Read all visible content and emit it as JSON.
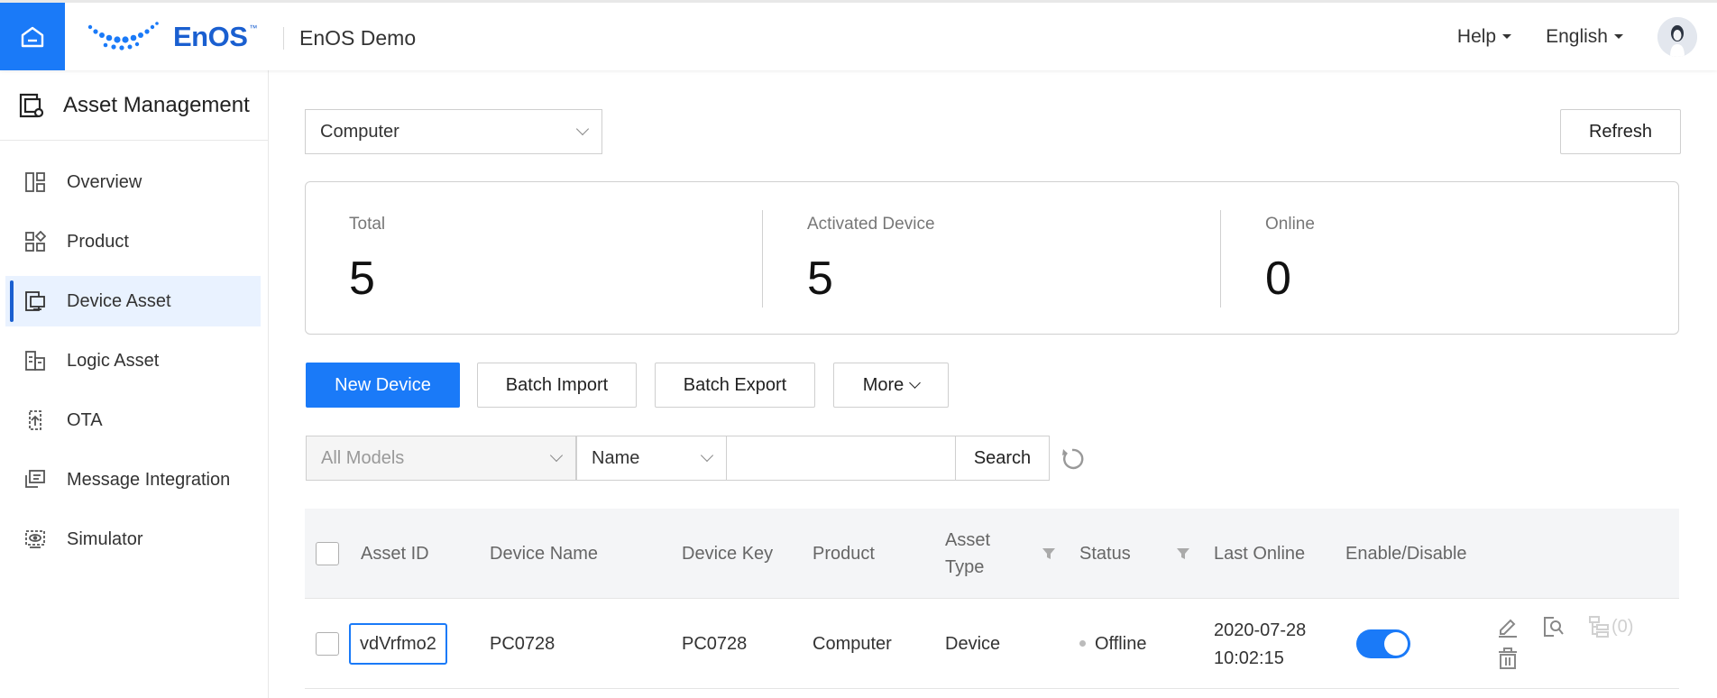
{
  "header": {
    "logo_text": "EnOS",
    "logo_tm": "™",
    "app_title": "EnOS Demo",
    "help_label": "Help",
    "language_label": "English"
  },
  "sidebar": {
    "title": "Asset Management",
    "items": [
      {
        "label": "Overview",
        "icon": "overview-icon"
      },
      {
        "label": "Product",
        "icon": "product-icon"
      },
      {
        "label": "Device Asset",
        "icon": "device-asset-icon",
        "active": true
      },
      {
        "label": "Logic Asset",
        "icon": "logic-asset-icon"
      },
      {
        "label": "OTA",
        "icon": "ota-icon"
      },
      {
        "label": "Message Integration",
        "icon": "message-integration-icon"
      },
      {
        "label": "Simulator",
        "icon": "simulator-icon"
      }
    ]
  },
  "main": {
    "product_select": "Computer",
    "refresh_label": "Refresh",
    "stats": [
      {
        "label": "Total",
        "value": "5"
      },
      {
        "label": "Activated Device",
        "value": "5"
      },
      {
        "label": "Online",
        "value": "0"
      }
    ],
    "actions": {
      "new_device": "New Device",
      "batch_import": "Batch Import",
      "batch_export": "Batch Export",
      "more": "More"
    },
    "filters": {
      "model_placeholder": "All Models",
      "field_select": "Name",
      "search_value": "",
      "search_label": "Search"
    },
    "table": {
      "columns": [
        "Asset ID",
        "Device Name",
        "Device Key",
        "Product",
        "Asset Type",
        "Status",
        "Last Online",
        "Enable/Disable"
      ],
      "rows": [
        {
          "asset_id": "vdVrfmo2",
          "device_name": "PC0728",
          "device_key": "PC0728",
          "product": "Computer",
          "asset_type": "Device",
          "status": "Offline",
          "last_online_date": "2020-07-28",
          "last_online_time": "10:02:15",
          "enabled": true,
          "topology_count": "(0)"
        }
      ]
    }
  },
  "colors": {
    "primary": "#1a7af8",
    "brand": "#1a5fd0",
    "active_bg": "#e9f2ff"
  }
}
